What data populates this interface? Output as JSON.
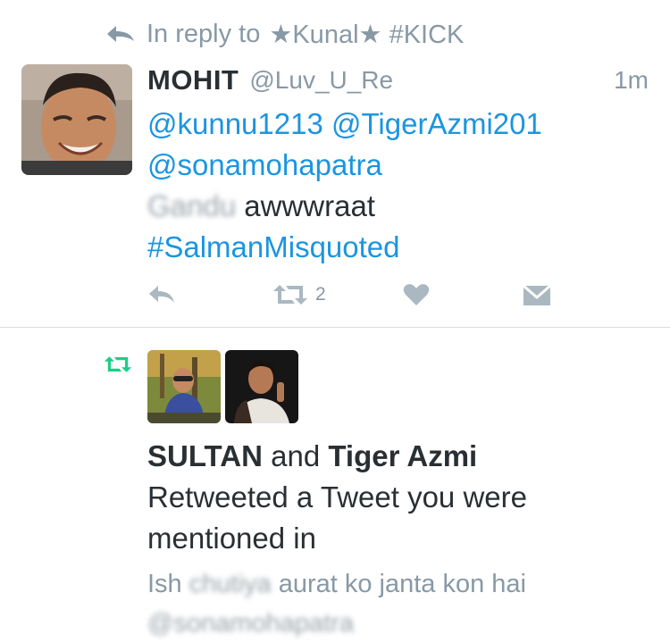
{
  "reply_context": {
    "prefix": "In reply to",
    "target": "★Kunal★ #KICK",
    "icon": "reply-arrow-icon"
  },
  "tweet": {
    "author_name": "MOHIT",
    "author_handle": "@Luv_U_Re",
    "time": "1m",
    "mention_1": "@kunnu1213",
    "mention_2": "@TigerAzmi201",
    "mention_3": "@sonamohapatra",
    "blurred_word": "Gandu",
    "text_word": "awwwraat",
    "hashtag": "#SalmanMisquoted",
    "retweet_count": "2",
    "icons": [
      "reply-icon",
      "retweet-icon",
      "like-heart-icon",
      "direct-message-icon"
    ]
  },
  "notification": {
    "icon": "retweet-icon",
    "user_1": "SULTAN",
    "joiner": "and",
    "user_2": "Tiger Azmi",
    "message": "Retweeted a Tweet you were mentioned in",
    "quoted_start": "Ish",
    "quoted_blurred": "chutiya",
    "quoted_rest": "aurat ko janta kon hai",
    "quoted_next_line": "@sonamohapatra"
  },
  "colors": {
    "link": "#1b95e0",
    "muted": "#8899a6",
    "icon_gray": "#aab8c2",
    "retweet_green": "#19cf86",
    "text": "#292f33"
  }
}
